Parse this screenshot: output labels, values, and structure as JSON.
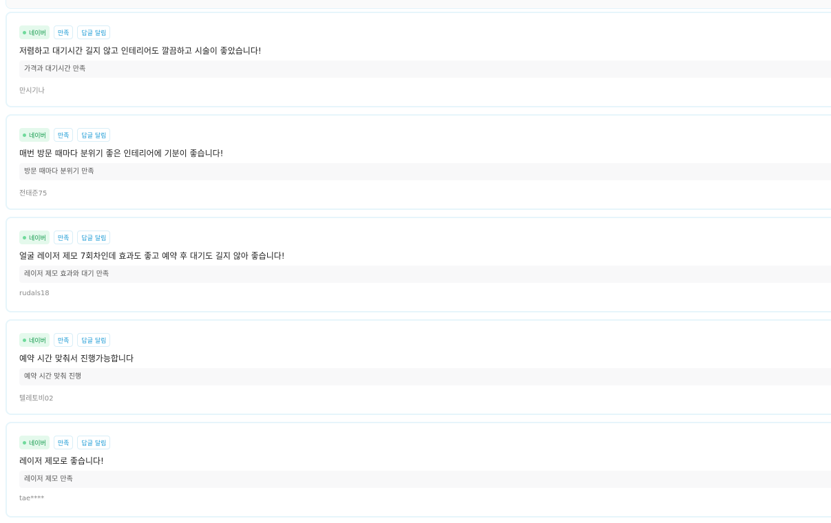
{
  "reviews": [
    {
      "platform": "네이버",
      "sentiment": "만족",
      "reply_status": "답글 달림",
      "text": "저렴하고 대기시간 길지 않고 인테리어도 깔끔하고 시술이 좋았습니다!",
      "summary": "가격과 대기시간 만족",
      "author": "만시기나"
    },
    {
      "platform": "네이버",
      "sentiment": "만족",
      "reply_status": "답글 달림",
      "text": "매번 방문 때마다 분위기 좋은 인테리어에 기분이 좋습니다!",
      "summary": "방문 때마다 분위기 만족",
      "author": "전태준75"
    },
    {
      "platform": "네이버",
      "sentiment": "만족",
      "reply_status": "답글 달림",
      "text": "얼굴 레이저 제모 7회차인데 효과도 좋고 예약 후 대기도 길지 않아 좋습니다!",
      "summary": "레이저 제모 효과와 대기 만족",
      "author": "rudals18"
    },
    {
      "platform": "네이버",
      "sentiment": "만족",
      "reply_status": "답글 달림",
      "text": "예약 시간 맞춰서 진행가능합니다",
      "summary": "예약 시간 맞춰 진행",
      "author": "텔레토비02"
    },
    {
      "platform": "네이버",
      "sentiment": "만족",
      "reply_status": "답글 달림",
      "text": "레이저 제모로 좋습니다!",
      "summary": "레이저 제모 만족",
      "author": "tae****"
    }
  ],
  "colors": {
    "platform_tag_bg": "#e4f9ec",
    "platform_tag_text": "#139a4d",
    "accent_tag_text": "#1e9cd6",
    "card_border": "#e6f5fb"
  }
}
